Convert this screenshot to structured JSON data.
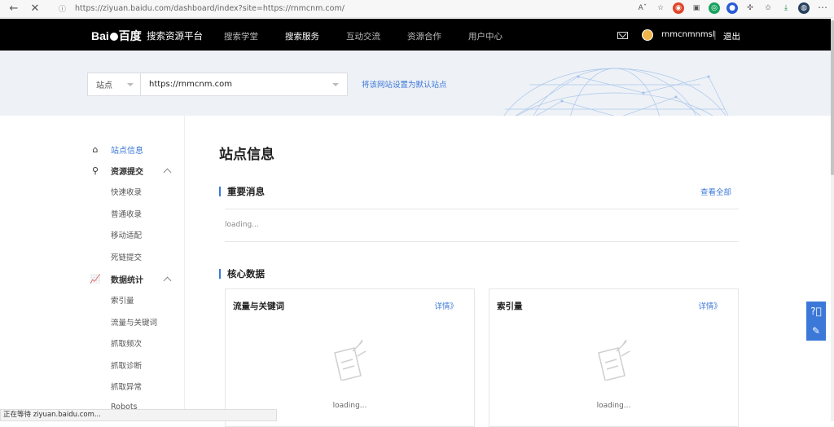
{
  "browser": {
    "url": "https://ziyuan.baidu.com/dashboard/index?site=https://rnmcnm.com/",
    "status": "正在等待 ziyuan.baidu.com..."
  },
  "topnav": {
    "logo": "Bai百度",
    "brand": "搜索资源平台",
    "items": [
      {
        "label": "搜索学堂",
        "active": false
      },
      {
        "label": "搜索服务",
        "active": true
      },
      {
        "label": "互动交流",
        "active": false
      },
      {
        "label": "资源合作",
        "active": false
      },
      {
        "label": "用户中心",
        "active": false
      }
    ],
    "username": "rnmcnmnmsl",
    "separator": "|",
    "logout": "退出"
  },
  "site_selector": {
    "label": "站点",
    "value": "https://rnmcnm.com",
    "set_default": "将该网站设置为默认站点"
  },
  "sidebar": {
    "site_info": "站点信息",
    "submit_group": "资源提交",
    "submit_items": [
      "快速收录",
      "普通收录",
      "移动适配",
      "死链提交"
    ],
    "stats_group": "数据统计",
    "stats_items": [
      "索引量",
      "流量与关键词",
      "抓取频次",
      "抓取诊断",
      "抓取异常",
      "Robots"
    ]
  },
  "main": {
    "title": "站点信息",
    "important_news": "重要消息",
    "view_all": "查看全部",
    "loading": "loading...",
    "core_data": "核心数据",
    "cards": [
      {
        "title": "流量与关键词",
        "detail": "详情》",
        "loading": "loading..."
      },
      {
        "title": "索引量",
        "detail": "详情》",
        "loading": "loading..."
      }
    ]
  },
  "colors": {
    "accent": "#3c78d8",
    "nav_bg": "#000000",
    "strip_bg": "#eef1f6"
  }
}
